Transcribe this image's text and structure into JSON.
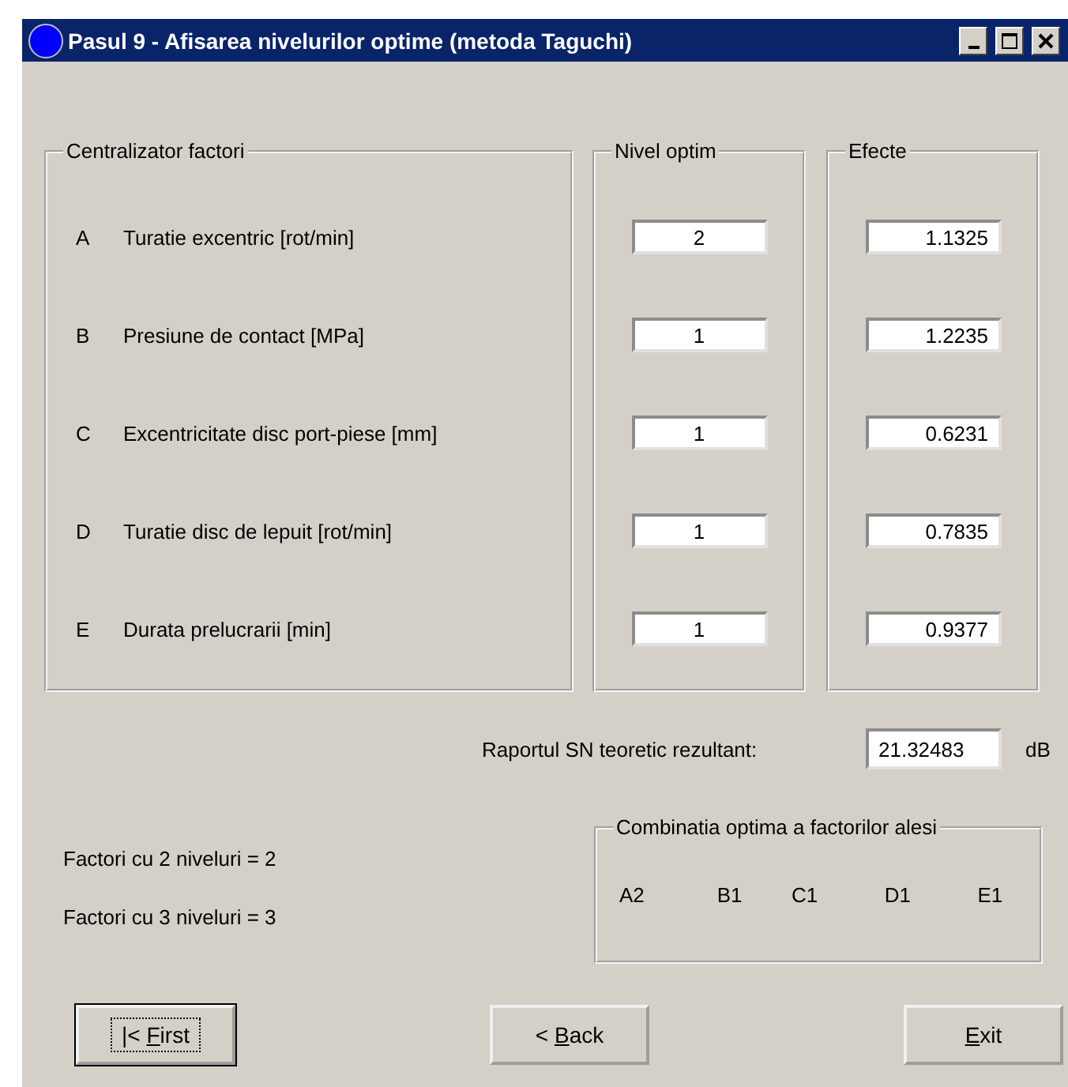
{
  "window": {
    "title": "Pasul 9 - Afisarea nivelurilor optime (metoda Taguchi)"
  },
  "groups": {
    "factors_title": "Centralizator factori",
    "levels_title": "Nivel optim",
    "effects_title": "Efecte"
  },
  "factors": [
    {
      "letter": "A",
      "name": "Turatie excentric [rot/min]",
      "optimal_level": "2",
      "effect": "1.1325"
    },
    {
      "letter": "B",
      "name": "Presiune de contact [MPa]",
      "optimal_level": "1",
      "effect": "1.2235"
    },
    {
      "letter": "C",
      "name": "Excentricitate disc port-piese [mm]",
      "optimal_level": "1",
      "effect": "0.6231"
    },
    {
      "letter": "D",
      "name": "Turatie disc de lepuit [rot/min]",
      "optimal_level": "1",
      "effect": "0.7835"
    },
    {
      "letter": "E",
      "name": "Durata prelucrarii [min]",
      "optimal_level": "1",
      "effect": "0.9377"
    }
  ],
  "sn_ratio": {
    "label": "Raportul SN teoretic rezultant:",
    "value": "21.32483",
    "unit": "dB"
  },
  "level_counts": [
    "Factori cu 2 niveluri = 2",
    "Factori cu 3 niveluri = 3"
  ],
  "combination": {
    "title": "Combinatia optima a factorilor alesi",
    "items": [
      "A2",
      "B1",
      "C1",
      "D1",
      "E1"
    ]
  },
  "buttons": [
    {
      "before": "|< ",
      "key": "F",
      "after": "irst",
      "focused": true
    },
    {
      "before": "< ",
      "key": "B",
      "after": "ack",
      "focused": false
    },
    {
      "key": "E",
      "after": "xit",
      "focused": false
    }
  ]
}
